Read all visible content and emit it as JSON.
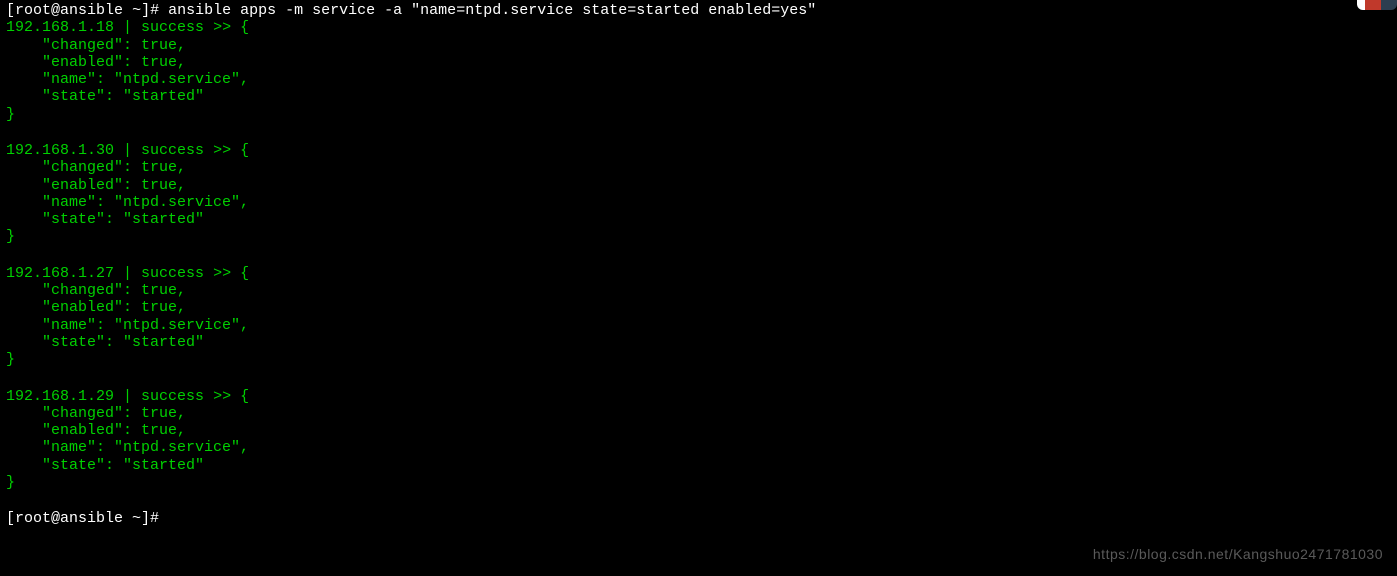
{
  "prompt": {
    "user": "root",
    "host": "ansible",
    "path": "~",
    "symbol": "#",
    "command": "ansible apps -m service -a \"name=ntpd.service state=started enabled=yes\""
  },
  "hosts": [
    {
      "ip": "192.168.1.18",
      "status": "success",
      "result": {
        "changed": "true",
        "enabled": "true",
        "name": "\"ntpd.service\"",
        "state": "\"started\""
      }
    },
    {
      "ip": "192.168.1.30",
      "status": "success",
      "result": {
        "changed": "true",
        "enabled": "true",
        "name": "\"ntpd.service\"",
        "state": "\"started\""
      }
    },
    {
      "ip": "192.168.1.27",
      "status": "success",
      "result": {
        "changed": "true",
        "enabled": "true",
        "name": "\"ntpd.service\"",
        "state": "\"started\""
      }
    },
    {
      "ip": "192.168.1.29",
      "status": "success",
      "result": {
        "changed": "true",
        "enabled": "true",
        "name": "\"ntpd.service\"",
        "state": "\"started\""
      }
    }
  ],
  "final_prompt": "[root@ansible ~]#",
  "watermark": "https://blog.csdn.net/Kangshuo2471781030"
}
